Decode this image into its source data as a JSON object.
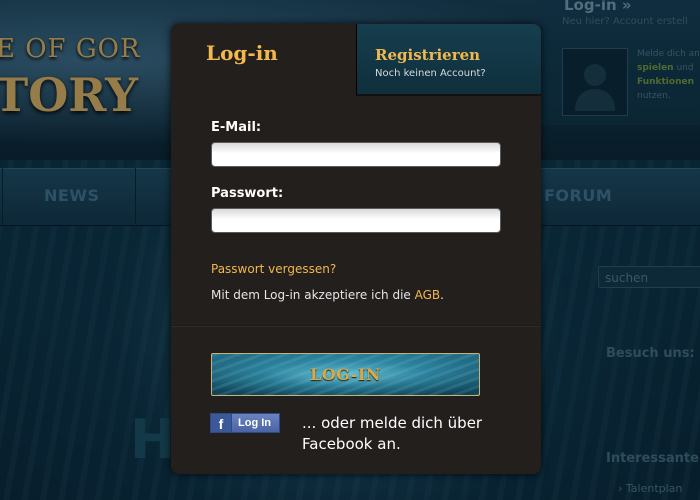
{
  "background": {
    "game_logo_top": "E OF GOR",
    "game_logo_bottom": "TORY",
    "nav": [
      "NEWS",
      "FORUM"
    ],
    "right_title": "Log-in »",
    "right_sub": "Neu hier? Account erstell",
    "right_text_line1": "Melde dich an",
    "right_text_bold1": "spielen",
    "right_text_mid": " und",
    "right_text_bold2": "Funktionen",
    "right_text_end": "nutzen.",
    "search_placeholder": "suchen",
    "besuch": "Besuch uns:",
    "interessant": "Interessante",
    "talent": "› Talentplan"
  },
  "modal": {
    "tab_login": "Log-in",
    "tab_register": "Registrieren",
    "tab_register_sub": "Noch keinen Account?",
    "email_label": "E-Mail:",
    "email_value": "",
    "password_label": "Passwort:",
    "password_value": "",
    "forgot_link": "Passwort vergessen?",
    "accept_text": "Mit dem Log-in akzeptiere ich die ",
    "agb_link": "AGB",
    "accept_suffix": ".",
    "login_button": "LOG-IN",
    "fb_button_icon": "f",
    "fb_button_label": "Log In",
    "fb_text": "... oder melde dich über Facebook an."
  },
  "colors": {
    "accent_gold": "#f2b84e",
    "modal_bg": "#221f1d",
    "register_tab_bg": "#163e4e"
  }
}
